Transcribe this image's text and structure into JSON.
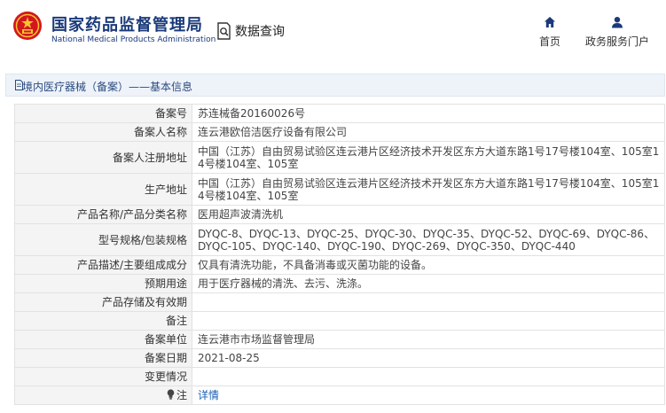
{
  "header": {
    "brand_cn": "国家药品监督管理局",
    "brand_en": "National Medical Products Administration",
    "site_title": "数据查询",
    "logo_icon": "national-emblem-icon",
    "nav": [
      {
        "label": "首页",
        "icon": "home-icon"
      },
      {
        "label": "政务服务门户",
        "icon": "user-icon"
      }
    ]
  },
  "section": {
    "title": "境内医疗器械（备案）——基本信息",
    "icon": "document-icon"
  },
  "record": {
    "rows": [
      {
        "label": "备案号",
        "value": "苏连械备20160026号"
      },
      {
        "label": "备案人名称",
        "value": "连云港欧倍洁医疗设备有限公司"
      },
      {
        "label": "备案人注册地址",
        "value": "中国（江苏）自由贸易试验区连云港片区经济技术开发区东方大道东路1号17号楼104室、105室14号楼104室、105室"
      },
      {
        "label": "生产地址",
        "value": "中国（江苏）自由贸易试验区连云港片区经济技术开发区东方大道东路1号17号楼104室、105室14号楼104室、105室"
      },
      {
        "label": "产品名称/产品分类名称",
        "value": "医用超声波清洗机"
      },
      {
        "label": "型号规格/包装规格",
        "value": "DYQC-8、DYQC-13、DYQC-25、DYQC-30、DYQC-35、DYQC-52、DYQC-69、DYQC-86、DYQC-105、DYQC-140、DYQC-190、DYQC-269、DYQC-350、DYQC-440"
      },
      {
        "label": "产品描述/主要组成成分",
        "value": "仅具有清洗功能，不具备消毒或灭菌功能的设备。"
      },
      {
        "label": "预期用途",
        "value": "用于医疗器械的清洗、去污、洗涤。"
      },
      {
        "label": "产品存储及有效期",
        "value": ""
      },
      {
        "label": "备注",
        "value": ""
      },
      {
        "label": "备案单位",
        "value": "连云港市市场监督管理局"
      },
      {
        "label": "备案日期",
        "value": "2021-08-25"
      },
      {
        "label": "变更情况",
        "value": ""
      }
    ],
    "note_label": "注",
    "note_link": "详情",
    "note_icon": "lightbulb-icon"
  },
  "colors": {
    "brand": "#1a3a7a",
    "link": "#1a5fb4",
    "label_bg": "#f4f4f4",
    "section_bg": "#eef3f9"
  }
}
